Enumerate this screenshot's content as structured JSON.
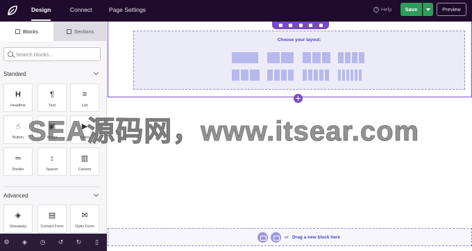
{
  "topbar": {
    "nav": [
      "Design",
      "Connect",
      "Page Settings"
    ],
    "help_label": "Help",
    "save_label": "Save",
    "preview_label": "Preview"
  },
  "sidebar": {
    "tabs": [
      "Blocks",
      "Sections"
    ],
    "search_placeholder": "Search blocks...",
    "standard": {
      "title": "Standard",
      "blocks": [
        {
          "label": "Headline",
          "icon": "headline-icon",
          "glyph": "H"
        },
        {
          "label": "Text",
          "icon": "paragraph-icon",
          "glyph": "¶"
        },
        {
          "label": "List",
          "icon": "list-icon",
          "glyph": "≡"
        },
        {
          "label": "Button",
          "icon": "button-hand-icon",
          "glyph": "☝"
        },
        {
          "label": "Image",
          "icon": "image-icon",
          "glyph": "▣"
        },
        {
          "label": "Video",
          "icon": "video-icon",
          "glyph": "▶"
        },
        {
          "label": "Divider",
          "icon": "divider-icon",
          "glyph": "═"
        },
        {
          "label": "Spacer",
          "icon": "spacer-icon",
          "glyph": "↕"
        },
        {
          "label": "Column",
          "icon": "column-icon",
          "glyph": "▥"
        }
      ]
    },
    "advanced": {
      "title": "Advanced",
      "blocks": [
        {
          "label": "Giveaway",
          "icon": "giveaway-icon",
          "glyph": "◈"
        },
        {
          "label": "Contact Form",
          "icon": "contact-form-icon",
          "glyph": "▤"
        },
        {
          "label": "Optin Form",
          "icon": "envelope-icon",
          "glyph": "✉"
        }
      ]
    }
  },
  "canvas": {
    "layout_title": "Choose your layout:",
    "dropzone_or": "or",
    "dropzone_text": "Drag a new block here"
  },
  "watermark": "SEA源码网，www.itsear.com",
  "colors": {
    "topbar": "#1f0b2b",
    "accent": "#7b4bc4",
    "save": "#2e9c5b",
    "layout_link": "#4a46c2"
  }
}
